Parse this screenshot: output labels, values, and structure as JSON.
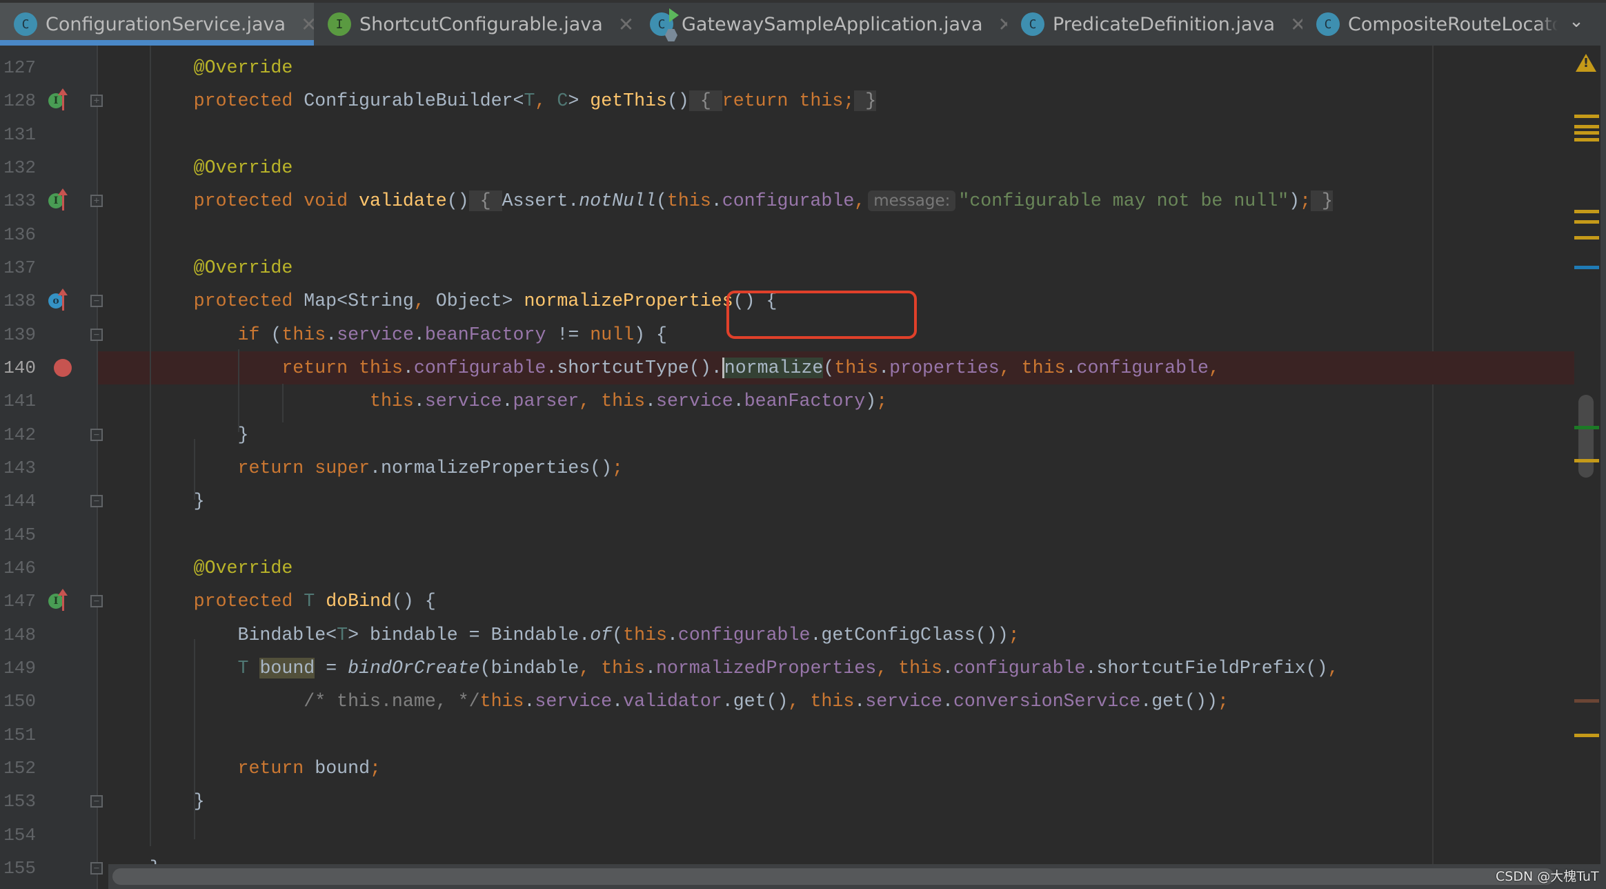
{
  "tabs": [
    {
      "label": "ConfigurationService.java",
      "icon": "class-icon",
      "glyph": "C",
      "active": true,
      "close": "✕"
    },
    {
      "label": "ShortcutConfigurable.java",
      "icon": "interface-icon",
      "glyph": "I",
      "active": false,
      "close": "✕"
    },
    {
      "label": "GatewaySampleApplication.java",
      "icon": "spring-boot-app-icon",
      "glyph": "C",
      "active": false,
      "close": "✕"
    },
    {
      "label": "PredicateDefinition.java",
      "icon": "class-icon",
      "glyph": "C",
      "active": false,
      "close": "✕"
    },
    {
      "label": "CompositeRouteLocato",
      "icon": "class-icon",
      "glyph": "C",
      "active": false,
      "truncated": true
    }
  ],
  "tab_more_glyph": "⌄",
  "current_line": 140,
  "lines": [
    {
      "n": 127,
      "tokens": [
        [
          "        ",
          ""
        ],
        [
          "@Override",
          "ann"
        ]
      ]
    },
    {
      "n": 128,
      "gutter": "implements-interface-method",
      "fold": "collapsed",
      "tokens": [
        [
          "        ",
          ""
        ],
        [
          "protected ",
          "kw"
        ],
        [
          "ConfigurableBuilder<",
          ""
        ],
        [
          "T",
          "tp"
        ],
        [
          ", ",
          "kw"
        ],
        [
          "C",
          "tp"
        ],
        [
          "> ",
          ""
        ],
        [
          "getThis",
          "fn"
        ],
        [
          "()",
          ""
        ],
        [
          " { ",
          "fph"
        ],
        [
          "return this;",
          "kw"
        ],
        [
          " }",
          "fph"
        ]
      ]
    },
    {
      "n": 131,
      "tokens": []
    },
    {
      "n": 132,
      "tokens": [
        [
          "        ",
          ""
        ],
        [
          "@Override",
          "ann"
        ]
      ]
    },
    {
      "n": 133,
      "gutter": "implements-interface-method",
      "fold": "collapsed",
      "tokens": [
        [
          "        ",
          ""
        ],
        [
          "protected ",
          "kw"
        ],
        [
          "void ",
          "kw"
        ],
        [
          "validate",
          "fn"
        ],
        [
          "()",
          ""
        ],
        [
          " { ",
          "fph"
        ],
        [
          "Assert.",
          ""
        ],
        [
          "notNull",
          "it"
        ],
        [
          "(",
          ""
        ],
        [
          "this",
          "kw"
        ],
        [
          ".",
          ""
        ],
        [
          "configurable",
          "fld"
        ],
        [
          ",",
          "kw"
        ],
        [
          "message:",
          "hint"
        ],
        [
          "\"configurable may not be null\"",
          "str"
        ],
        [
          ")",
          ""
        ],
        [
          ";",
          "kw"
        ],
        [
          " }",
          "fph"
        ]
      ]
    },
    {
      "n": 136,
      "tokens": []
    },
    {
      "n": 137,
      "tokens": [
        [
          "        ",
          ""
        ],
        [
          "@Override",
          "ann"
        ]
      ]
    },
    {
      "n": 138,
      "gutter": "overrides-method",
      "fold": "open",
      "tokens": [
        [
          "        ",
          ""
        ],
        [
          "protected ",
          "kw"
        ],
        [
          "Map<String",
          ""
        ],
        [
          ", ",
          "kw"
        ],
        [
          "Object> ",
          ""
        ],
        [
          "normalizeProperties",
          "fn"
        ],
        [
          "() {",
          ""
        ]
      ]
    },
    {
      "n": 139,
      "fold": "open",
      "tokens": [
        [
          "            ",
          ""
        ],
        [
          "if ",
          "kw"
        ],
        [
          "(",
          ""
        ],
        [
          "this",
          "kw"
        ],
        [
          ".",
          ""
        ],
        [
          "service",
          "fld"
        ],
        [
          ".",
          ""
        ],
        [
          "beanFactory",
          "fld"
        ],
        [
          " != ",
          ""
        ],
        [
          "null",
          "kw"
        ],
        [
          ") {",
          ""
        ]
      ]
    },
    {
      "n": 140,
      "breakpoint": true,
      "tokens": [
        [
          "                ",
          ""
        ],
        [
          "return ",
          "kw"
        ],
        [
          "this",
          "kw"
        ],
        [
          ".",
          ""
        ],
        [
          "configurable",
          "fld"
        ],
        [
          ".shortcutType().",
          ""
        ],
        [
          "normalize",
          "ident-hl caret"
        ],
        [
          "(",
          ""
        ],
        [
          "this",
          "kw"
        ],
        [
          ".",
          ""
        ],
        [
          "properties",
          "fld"
        ],
        [
          ", ",
          "kw"
        ],
        [
          "this",
          "kw"
        ],
        [
          ".",
          ""
        ],
        [
          "configurable",
          "fld"
        ],
        [
          ",",
          "kw"
        ]
      ]
    },
    {
      "n": 141,
      "tokens": [
        [
          "                        ",
          ""
        ],
        [
          "this",
          "kw"
        ],
        [
          ".",
          ""
        ],
        [
          "service",
          "fld"
        ],
        [
          ".",
          ""
        ],
        [
          "parser",
          "fld"
        ],
        [
          ", ",
          "kw"
        ],
        [
          "this",
          "kw"
        ],
        [
          ".",
          ""
        ],
        [
          "service",
          "fld"
        ],
        [
          ".",
          ""
        ],
        [
          "beanFactory",
          "fld"
        ],
        [
          ")",
          ""
        ],
        [
          ";",
          "kw"
        ]
      ]
    },
    {
      "n": 142,
      "fold": "close",
      "tokens": [
        [
          "            }",
          ""
        ]
      ]
    },
    {
      "n": 143,
      "tokens": [
        [
          "            ",
          ""
        ],
        [
          "return ",
          "kw"
        ],
        [
          "super",
          "kw"
        ],
        [
          ".normalizeProperties()",
          ""
        ],
        [
          ";",
          "kw"
        ]
      ]
    },
    {
      "n": 144,
      "fold": "close",
      "tokens": [
        [
          "        }",
          ""
        ]
      ]
    },
    {
      "n": 145,
      "tokens": []
    },
    {
      "n": 146,
      "tokens": [
        [
          "        ",
          ""
        ],
        [
          "@Override",
          "ann"
        ]
      ]
    },
    {
      "n": 147,
      "gutter": "implements-interface-method",
      "fold": "open",
      "tokens": [
        [
          "        ",
          ""
        ],
        [
          "protected ",
          "kw"
        ],
        [
          "T ",
          "tp"
        ],
        [
          "doBind",
          "fn"
        ],
        [
          "() {",
          ""
        ]
      ]
    },
    {
      "n": 148,
      "tokens": [
        [
          "            Bindable<",
          ""
        ],
        [
          "T",
          "tp"
        ],
        [
          "> bindable = Bindable.",
          ""
        ],
        [
          "of",
          "it"
        ],
        [
          "(",
          ""
        ],
        [
          "this",
          "kw"
        ],
        [
          ".",
          ""
        ],
        [
          "configurable",
          "fld"
        ],
        [
          ".getConfigClass())",
          ""
        ],
        [
          ";",
          "kw"
        ]
      ]
    },
    {
      "n": 149,
      "tokens": [
        [
          "            ",
          ""
        ],
        [
          "T ",
          "tp"
        ],
        [
          "bound",
          "write-hl"
        ],
        [
          " = ",
          ""
        ],
        [
          "bindOrCreate",
          "it"
        ],
        [
          "(bindable",
          ""
        ],
        [
          ", ",
          "kw"
        ],
        [
          "this",
          "kw"
        ],
        [
          ".",
          ""
        ],
        [
          "normalizedProperties",
          "fld"
        ],
        [
          ", ",
          "kw"
        ],
        [
          "this",
          "kw"
        ],
        [
          ".",
          ""
        ],
        [
          "configurable",
          "fld"
        ],
        [
          ".shortcutFieldPrefix()",
          ""
        ],
        [
          ",",
          "kw"
        ]
      ]
    },
    {
      "n": 150,
      "tokens": [
        [
          "                  ",
          ""
        ],
        [
          "/* this.name, */",
          "cm"
        ],
        [
          "this",
          "kw"
        ],
        [
          ".",
          ""
        ],
        [
          "service",
          "fld"
        ],
        [
          ".",
          ""
        ],
        [
          "validator",
          "fld"
        ],
        [
          ".get()",
          ""
        ],
        [
          ", ",
          "kw"
        ],
        [
          "this",
          "kw"
        ],
        [
          ".",
          ""
        ],
        [
          "service",
          "fld"
        ],
        [
          ".",
          ""
        ],
        [
          "conversionService",
          "fld"
        ],
        [
          ".get())",
          ""
        ],
        [
          ";",
          "kw"
        ]
      ]
    },
    {
      "n": 151,
      "tokens": []
    },
    {
      "n": 152,
      "tokens": [
        [
          "            ",
          ""
        ],
        [
          "return ",
          "kw"
        ],
        [
          "bound",
          ""
        ],
        [
          ";",
          "kw"
        ]
      ]
    },
    {
      "n": 153,
      "fold": "close",
      "tokens": [
        [
          "        }",
          ""
        ]
      ]
    },
    {
      "n": 154,
      "tokens": []
    },
    {
      "n": 155,
      "fold": "close",
      "tokens": [
        [
          "    }",
          ""
        ]
      ]
    }
  ],
  "error_stripe": {
    "warning_icon": "warning-icon",
    "marks": [
      {
        "color": "#c59a19"
      },
      {
        "color": "#c59a19"
      },
      {
        "color": "#c59a19"
      },
      {
        "color": "#c59a19"
      },
      {
        "color": "#c59a19"
      },
      {
        "color": "#c59a19"
      },
      {
        "color": "#c59a19"
      },
      {
        "color": "#1f7bb5"
      },
      {
        "color": "#1c7a26"
      },
      {
        "color": "#c59a19"
      },
      {
        "color": "#6b4535"
      },
      {
        "color": "#c59a19"
      }
    ]
  },
  "highlight": {
    "line": 140,
    "annotation": "red-box around this.properties"
  },
  "watermark": "CSDN @大槐TuT"
}
